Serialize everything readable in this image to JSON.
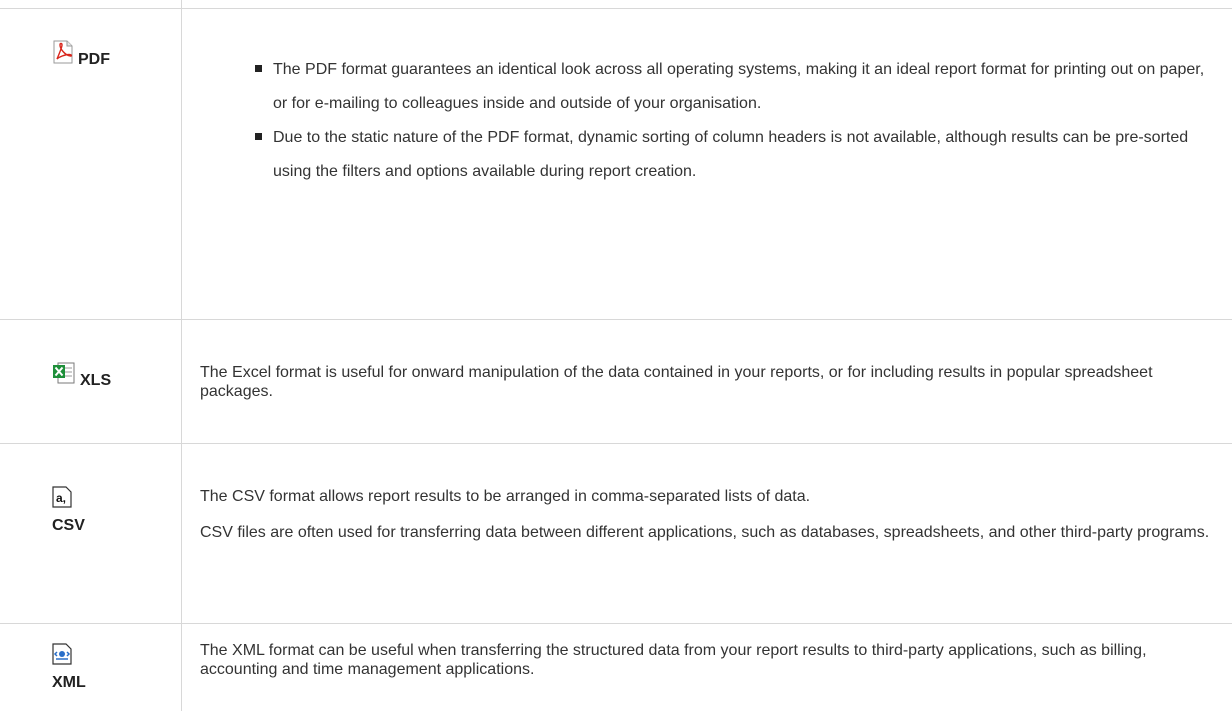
{
  "rows": [
    {
      "icon": "pdf-icon",
      "label": "PDF",
      "bullets": [
        "The PDF format guarantees an identical look across all operating systems, making it an ideal report format for printing out on paper, or for e-mailing to colleagues inside and outside of your organisation.",
        "Due to the static nature of the PDF format, dynamic sorting of column headers is not available, although results can be pre-sorted using the filters and options available during report creation."
      ]
    },
    {
      "icon": "excel-icon",
      "label": "XLS",
      "paragraphs": [
        "The Excel format is useful for onward manipulation of the data contained in your reports, or for including results in popular spreadsheet packages."
      ]
    },
    {
      "icon": "csv-icon",
      "icon_glyph": "a,",
      "label": "CSV",
      "paragraphs": [
        "The CSV format allows report results to be arranged in comma-separated lists of data.",
        "CSV files are often used for transferring data between different applications, such as databases, spreadsheets, and other third-party programs."
      ]
    },
    {
      "icon": "xml-icon",
      "label": "XML",
      "paragraphs": [
        "The XML format can be useful when transferring the structured data from your report results to third-party applications, such as billing, accounting and time management applications."
      ]
    }
  ],
  "colors": {
    "border": "#d8d8d8",
    "pdf_red": "#d9261c",
    "excel_green": "#1e8f3a",
    "xml_blue": "#2a6fc9"
  }
}
